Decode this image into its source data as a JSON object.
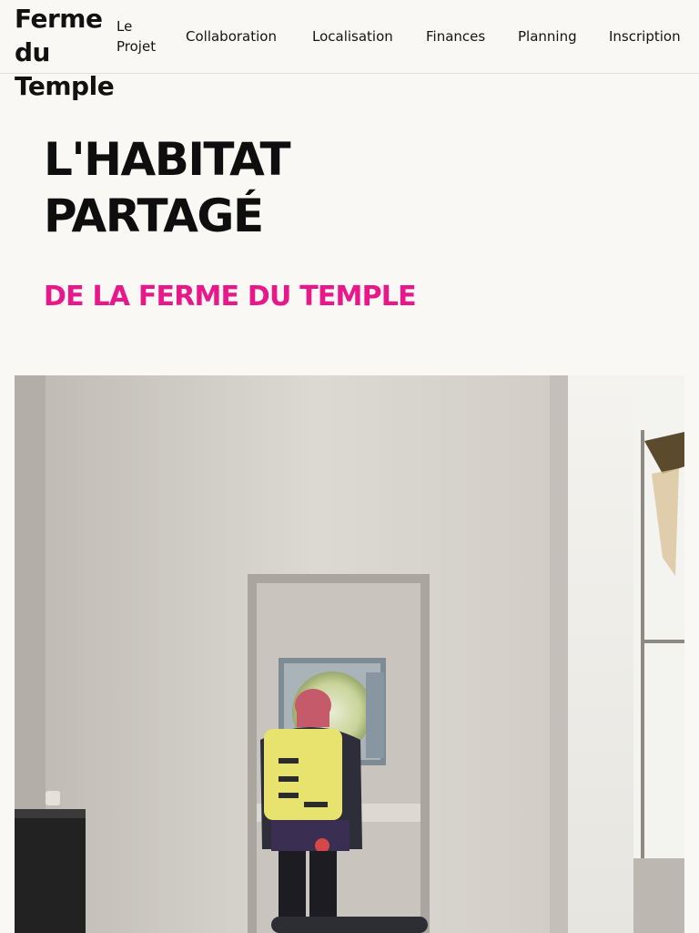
{
  "brand": {
    "name": "Ferme\ndu\nTemple"
  },
  "nav": {
    "items": [
      {
        "label": "Le\nProjet"
      },
      {
        "label": "Collaboration"
      },
      {
        "label": "Localisation"
      },
      {
        "label": "Finances"
      },
      {
        "label": "Planning"
      },
      {
        "label": "Inscription"
      }
    ]
  },
  "hero": {
    "title": "L'HABITAT\nPARTAGÉ",
    "subtitle": "DE LA FERME DU TEMPLE"
  },
  "colors": {
    "background": "#f9f8f5",
    "accent": "#e8178a",
    "text": "#141414"
  }
}
